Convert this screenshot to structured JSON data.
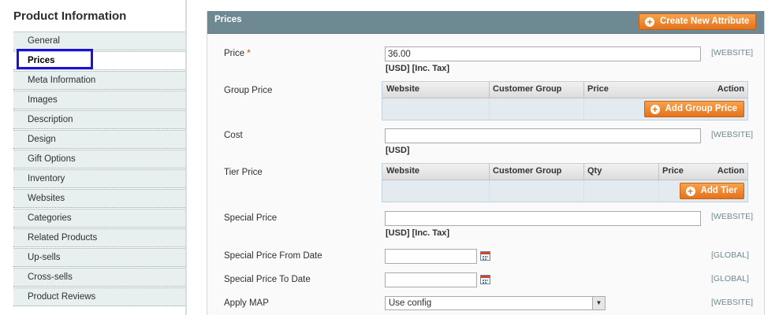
{
  "sidebar": {
    "title": "Product Information",
    "tabs": [
      {
        "label": "General"
      },
      {
        "label": "Prices"
      },
      {
        "label": "Meta Information"
      },
      {
        "label": "Images"
      },
      {
        "label": "Description"
      },
      {
        "label": "Design"
      },
      {
        "label": "Gift Options"
      },
      {
        "label": "Inventory"
      },
      {
        "label": "Websites"
      },
      {
        "label": "Categories"
      },
      {
        "label": "Related Products"
      },
      {
        "label": "Up-sells"
      },
      {
        "label": "Cross-sells"
      },
      {
        "label": "Product Reviews"
      }
    ],
    "active_tab": "Prices"
  },
  "panel": {
    "title": "Prices",
    "create_attribute_label": "Create New Attribute"
  },
  "fields": {
    "price": {
      "label": "Price",
      "required_mark": "*",
      "value": "36.00",
      "note": "[USD] [Inc. Tax]",
      "scope": "[WEBSITE]"
    },
    "group_price": {
      "label": "Group Price",
      "columns": [
        "Website",
        "Customer Group",
        "Price",
        "Action"
      ],
      "add_label": "Add Group Price"
    },
    "cost": {
      "label": "Cost",
      "value": "",
      "note": "[USD]",
      "scope": "[WEBSITE]"
    },
    "tier_price": {
      "label": "Tier Price",
      "columns": [
        "Website",
        "Customer Group",
        "Qty",
        "Price",
        "Action"
      ],
      "add_label": "Add Tier"
    },
    "special_price": {
      "label": "Special Price",
      "value": "",
      "note": "[USD] [Inc. Tax]",
      "scope": "[WEBSITE]"
    },
    "special_from": {
      "label": "Special Price From Date",
      "value": "",
      "scope": "[GLOBAL]"
    },
    "special_to": {
      "label": "Special Price To Date",
      "value": "",
      "scope": "[GLOBAL]"
    },
    "apply_map": {
      "label": "Apply MAP",
      "value": "Use config",
      "scope": "[WEBSITE]"
    }
  },
  "colors": {
    "header_bg": "#6f8992",
    "button_orange": "#ef8b2a",
    "active_outline": "#1a10e0",
    "required": "#eb340a"
  }
}
